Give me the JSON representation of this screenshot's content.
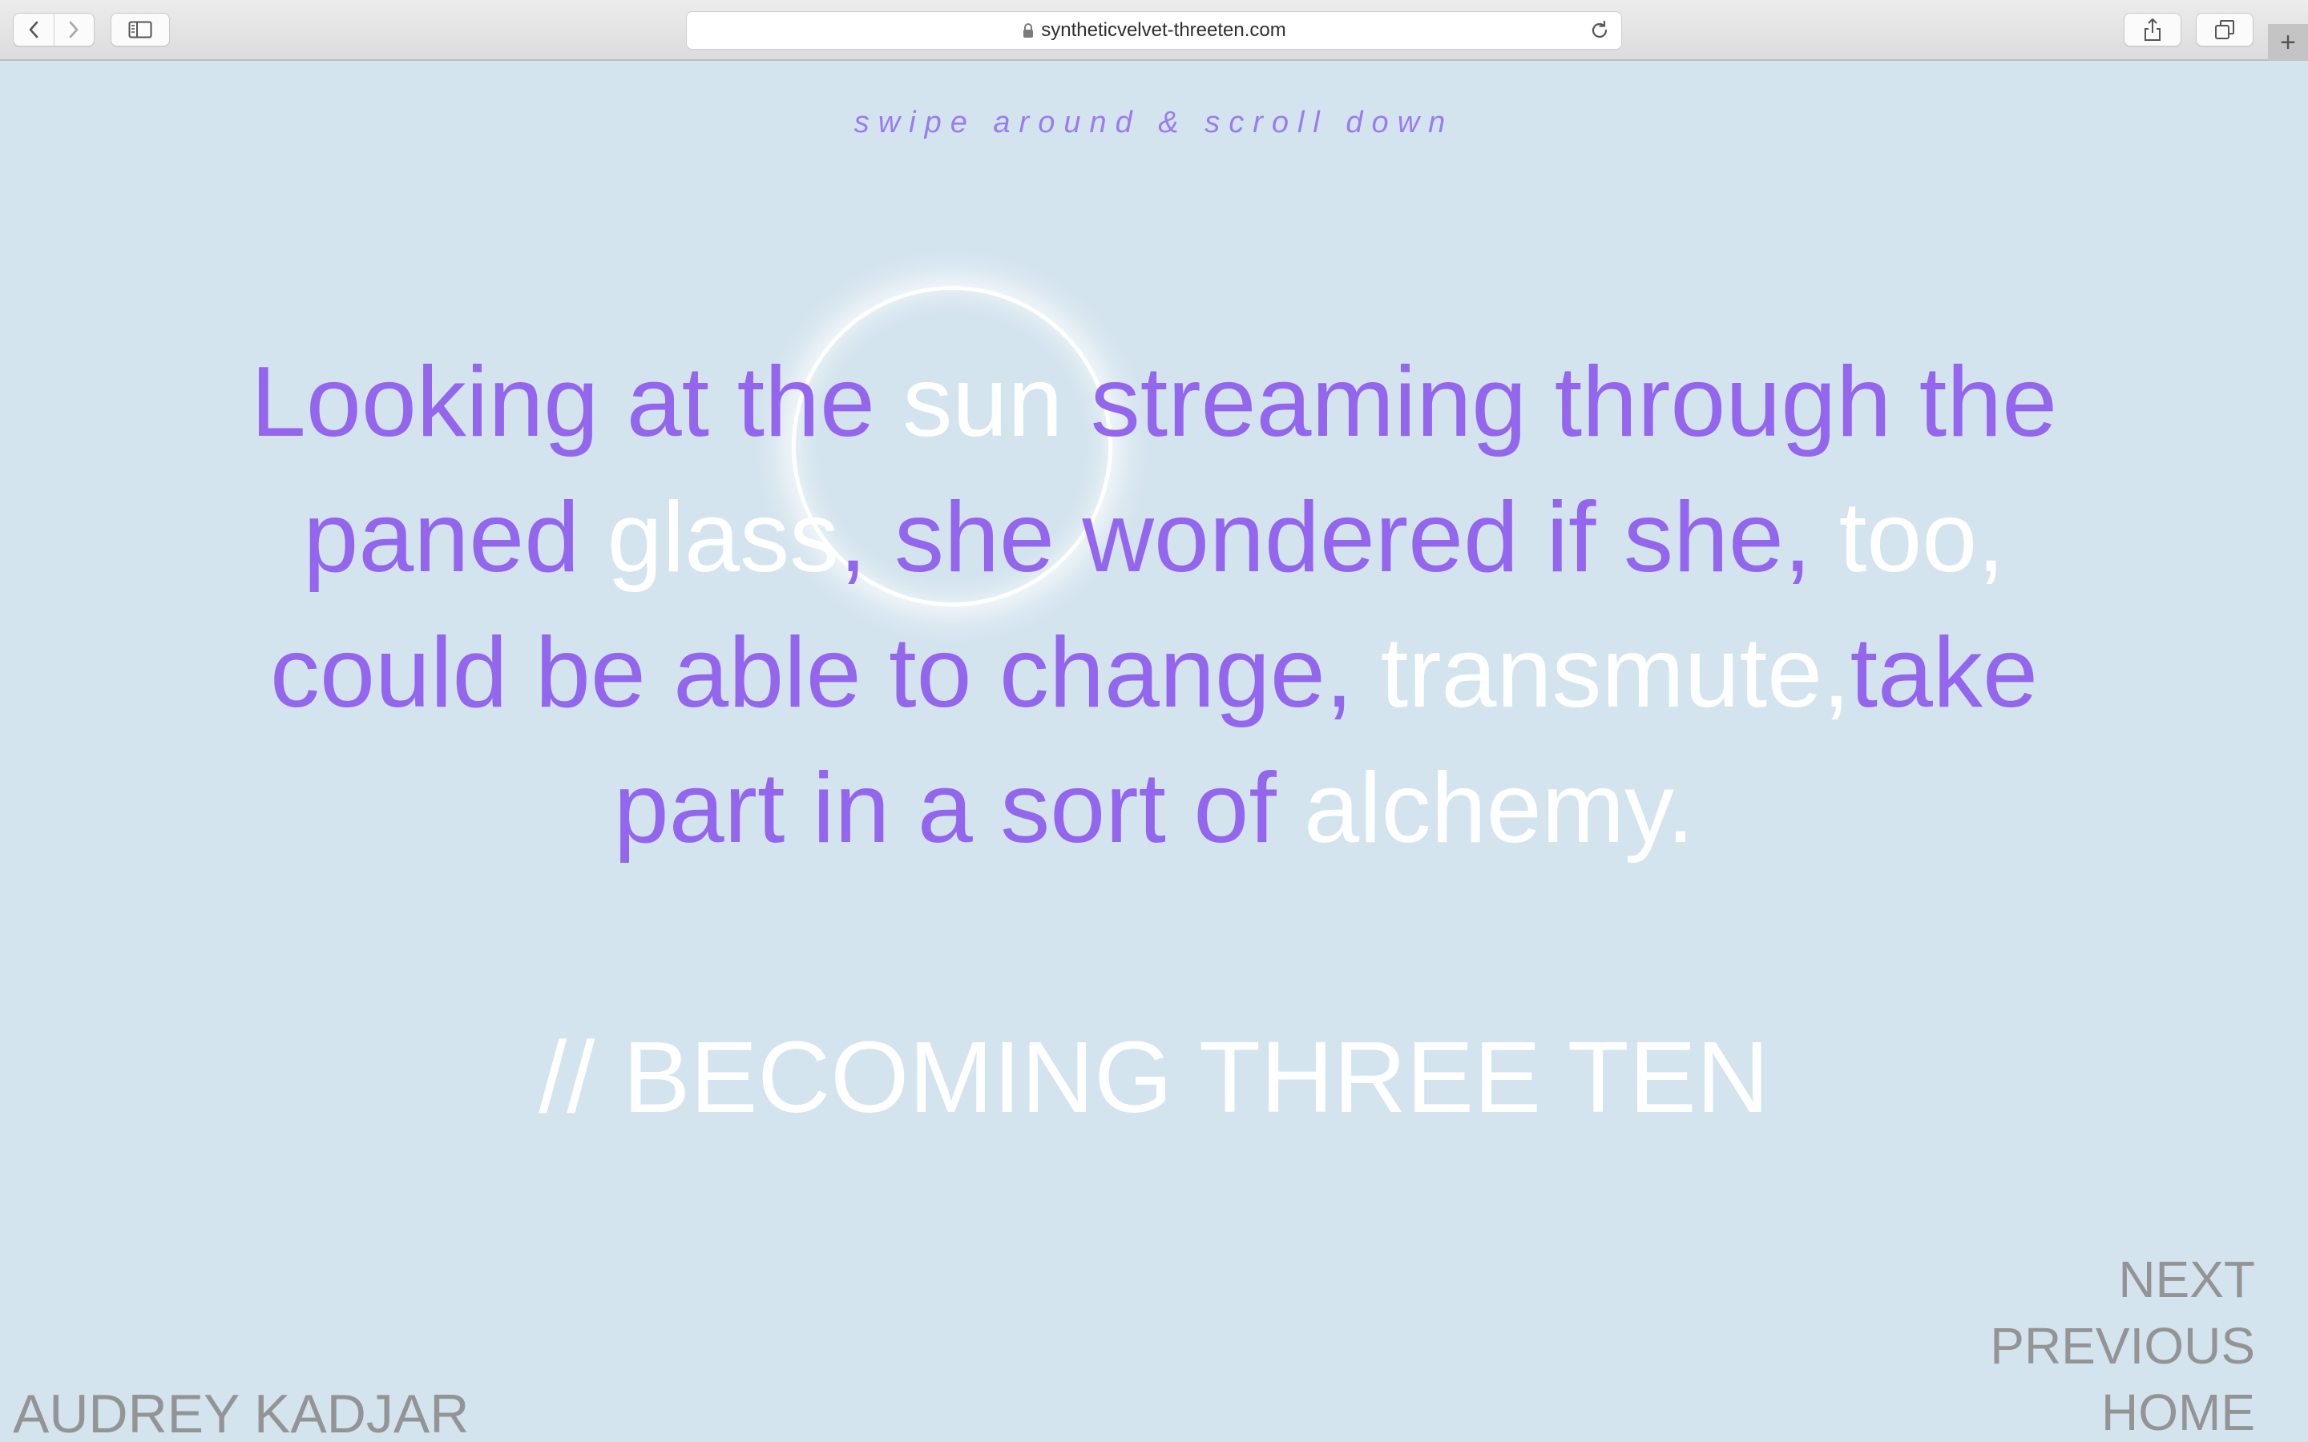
{
  "browser": {
    "url": "syntheticvelvet-threeten.com",
    "new_tab_label": "+"
  },
  "page": {
    "hint": "swipe around & scroll down",
    "quote_segments": [
      {
        "text": "Looking at the ",
        "color": "purple"
      },
      {
        "text": "sun",
        "color": "white"
      },
      {
        "text": " streaming through the paned ",
        "color": "purple"
      },
      {
        "text": "glass",
        "color": "white"
      },
      {
        "text": ", she wondered if she, ",
        "color": "purple"
      },
      {
        "text": "too,",
        "color": "white"
      },
      {
        "text": " could be able to change, ",
        "color": "purple"
      },
      {
        "text": "transmute,",
        "color": "white"
      },
      {
        "text": "take part in a sort of ",
        "color": "purple"
      },
      {
        "text": "alchemy.",
        "color": "white"
      }
    ],
    "title": "// BECOMING THREE TEN",
    "nav": {
      "next": "NEXT",
      "previous": "PREVIOUS",
      "home": "HOME"
    },
    "author": "AUDREY KADJAR"
  },
  "colors": {
    "background": "#d4e4ee",
    "purple": "#9466ee",
    "white": "#ffffff",
    "gray": "#949494"
  }
}
